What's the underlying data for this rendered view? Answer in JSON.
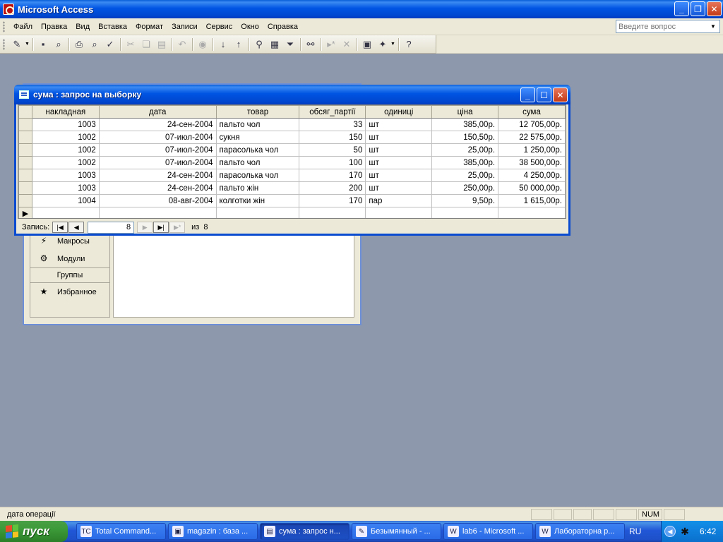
{
  "app": {
    "title": "Microsoft Access"
  },
  "menu": [
    "Файл",
    "Правка",
    "Вид",
    "Вставка",
    "Формат",
    "Записи",
    "Сервис",
    "Окно",
    "Справка"
  ],
  "ask": {
    "placeholder": "Введите вопрос"
  },
  "toolbar": {
    "icons": [
      "design-view-icon",
      "save-icon",
      "search-file-icon",
      "print-icon",
      "print-preview-icon",
      "spelling-icon",
      "cut-icon",
      "copy-icon",
      "paste-icon",
      "undo-icon",
      "hyperlink-icon",
      "sort-ascending-icon",
      "sort-descending-icon",
      "filter-by-selection-icon",
      "filter-by-form-icon",
      "apply-filter-icon",
      "find-icon",
      "new-record-icon",
      "delete-record-icon",
      "database-window-icon",
      "new-object-icon",
      "help-icon"
    ]
  },
  "db_window": {
    "items": [
      {
        "label": "Макросы",
        "icon": "macro-icon"
      },
      {
        "label": "Модули",
        "icon": "module-icon"
      }
    ],
    "groups_header": "Группы",
    "favorites": {
      "label": "Избранное",
      "icon": "favorites-icon"
    }
  },
  "query": {
    "title": "сума : запрос на выборку",
    "columns": [
      "накладная",
      "дата",
      "товар",
      "обсяг_партії",
      "одиниці",
      "ціна",
      "сума"
    ],
    "rows": [
      [
        "1003",
        "24-сен-2004",
        "пальто чол",
        "33",
        "шт",
        "385,00р.",
        "12 705,00р."
      ],
      [
        "1002",
        "07-июл-2004",
        "сукня",
        "150",
        "шт",
        "150,50р.",
        "22 575,00р."
      ],
      [
        "1002",
        "07-июл-2004",
        "парасолька чол",
        "50",
        "шт",
        "25,00р.",
        "1 250,00р."
      ],
      [
        "1002",
        "07-июл-2004",
        "пальто чол",
        "100",
        "шт",
        "385,00р.",
        "38 500,00р."
      ],
      [
        "1003",
        "24-сен-2004",
        "парасолька чол",
        "170",
        "шт",
        "25,00р.",
        "4 250,00р."
      ],
      [
        "1003",
        "24-сен-2004",
        "пальто жін",
        "200",
        "шт",
        "250,00р.",
        "50 000,00р."
      ],
      [
        "1004",
        "08-авг-2004",
        "колготки жін",
        "170",
        "пар",
        "9,50р.",
        "1 615,00р."
      ]
    ],
    "navigator": {
      "label": "Запись:",
      "current": "8",
      "of_label": "из",
      "total": "8"
    }
  },
  "status": {
    "text": "дата операції",
    "num": "NUM"
  },
  "taskbar": {
    "start": "пуск",
    "items": [
      {
        "label": "Total Command...",
        "icon": "total-commander-icon",
        "active": false
      },
      {
        "label": "magazin : база ...",
        "icon": "access-db-icon",
        "active": false
      },
      {
        "label": "сума : запрос н...",
        "icon": "query-icon",
        "active": true
      },
      {
        "label": "Безымянный - ...",
        "icon": "paint-icon",
        "active": false
      },
      {
        "label": "lab6 - Microsoft ...",
        "icon": "word-icon",
        "active": false
      },
      {
        "label": "Лабораторна р...",
        "icon": "word-icon",
        "active": false
      }
    ],
    "lang": "RU",
    "clock": "6:42"
  }
}
